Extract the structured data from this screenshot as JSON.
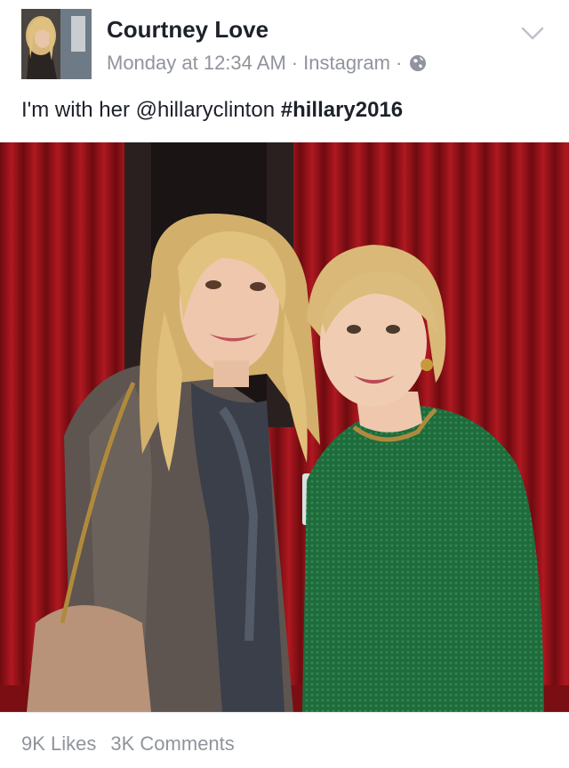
{
  "post": {
    "author": "Courtney Love",
    "time": "Monday at 12:34 AM",
    "separator": "·",
    "source": "Instagram",
    "text_plain": "I'm with her ",
    "mention": "@hillaryclinton",
    "hashtag": "#hillary2016",
    "privacy_icon": "globe-icon",
    "menu_icon": "chevron-down-icon"
  },
  "footer": {
    "likes": "9K Likes",
    "comments": "3K Comments"
  },
  "colors": {
    "text": "#1d2129",
    "meta": "#90949c",
    "curtain": "#8e1116",
    "sweater": "#1f6b3c"
  }
}
